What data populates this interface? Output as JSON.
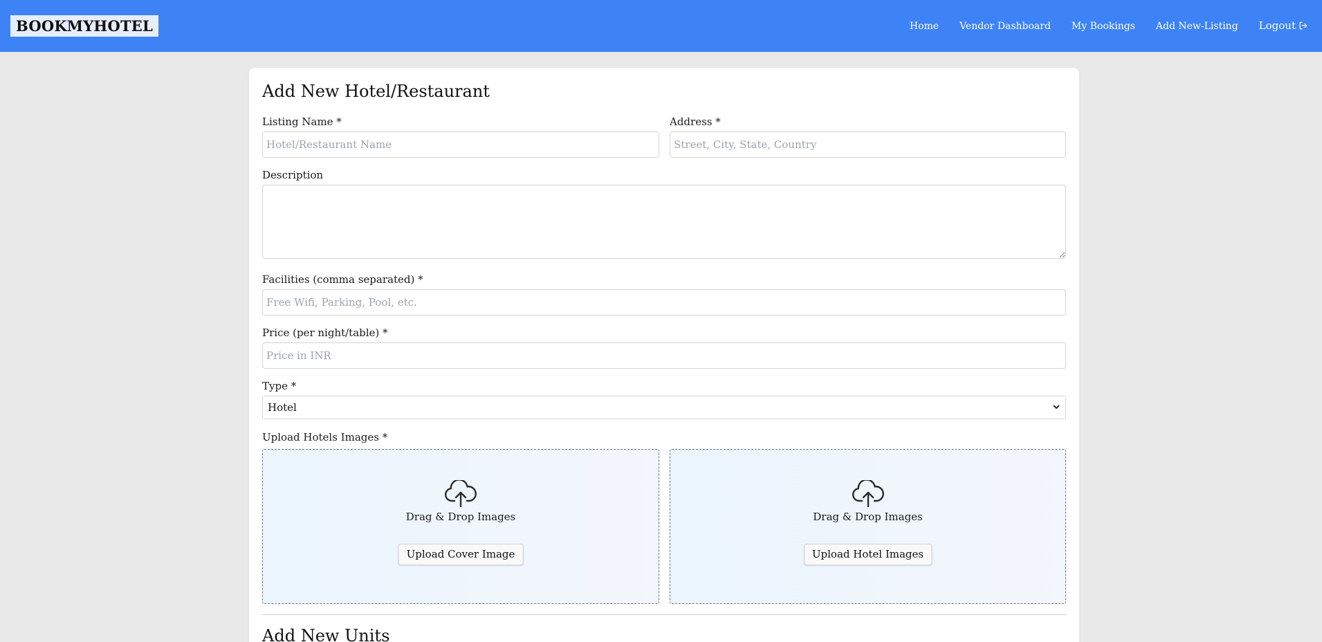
{
  "navbar": {
    "logo": "BOOKMYHOTEL",
    "links": [
      "Home",
      "Vendor Dashboard",
      "My Bookings",
      "Add New-Listing"
    ],
    "logout_label": "Logout",
    "logout_icon": "logout-icon",
    "background_color": "#3e83f6"
  },
  "form": {
    "title": "Add New Hotel/Restaurant",
    "listing_name": {
      "label": "Listing Name *",
      "placeholder": "Hotel/Restaurant Name",
      "value": ""
    },
    "address": {
      "label": "Address *",
      "placeholder": "Street, City, State, Country",
      "value": ""
    },
    "description": {
      "label": "Description",
      "value": ""
    },
    "facilities": {
      "label": "Facilities (comma separated) *",
      "placeholder": "Free Wifi, Parking, Pool, etc.",
      "value": ""
    },
    "price": {
      "label": "Price (per night/table) *",
      "placeholder": "Price in INR",
      "value": ""
    },
    "type": {
      "label": "Type *",
      "selected": "Hotel"
    },
    "upload": {
      "label": "Upload Hotels Images *",
      "cover": {
        "text": "Drag & Drop Images",
        "button": "Upload Cover Image",
        "icon": "cloud-upload-icon"
      },
      "hotel": {
        "text": "Drag & Drop Images",
        "button": "Upload Hotel Images",
        "icon": "cloud-upload-icon"
      }
    }
  },
  "units": {
    "title": "Add New Units"
  }
}
